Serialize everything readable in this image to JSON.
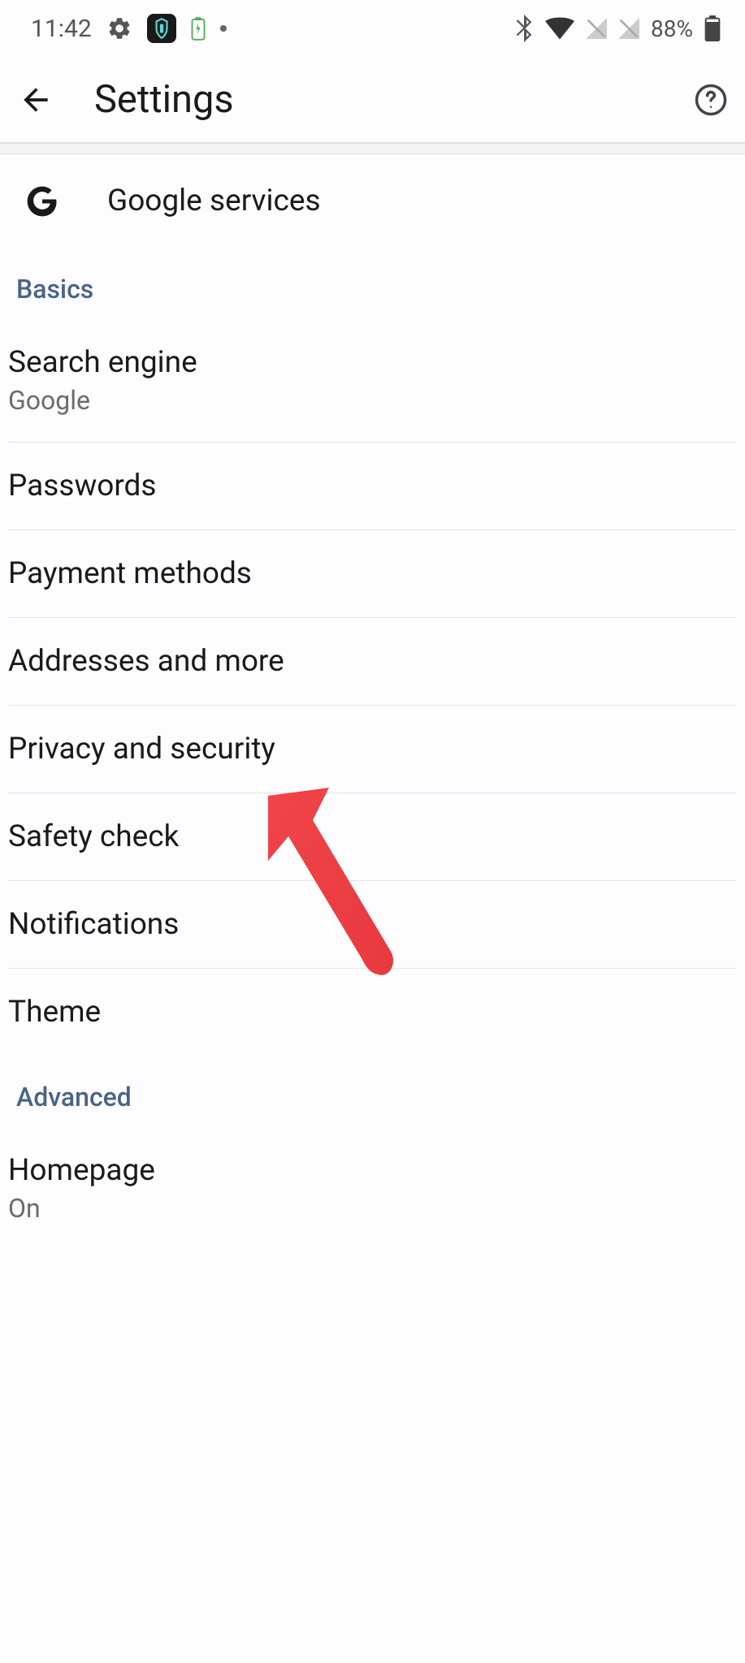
{
  "status_bar": {
    "time": "11:42",
    "battery_percent": "88%"
  },
  "header": {
    "title": "Settings"
  },
  "google_services": {
    "label": "Google services"
  },
  "sections": {
    "basics": {
      "header": "Basics",
      "items": [
        {
          "title": "Search engine",
          "subtitle": "Google"
        },
        {
          "title": "Passwords"
        },
        {
          "title": "Payment methods"
        },
        {
          "title": "Addresses and more"
        },
        {
          "title": "Privacy and security"
        },
        {
          "title": "Safety check"
        },
        {
          "title": "Notifications"
        },
        {
          "title": "Theme"
        }
      ]
    },
    "advanced": {
      "header": "Advanced",
      "items": [
        {
          "title": "Homepage",
          "subtitle": "On"
        }
      ]
    }
  }
}
